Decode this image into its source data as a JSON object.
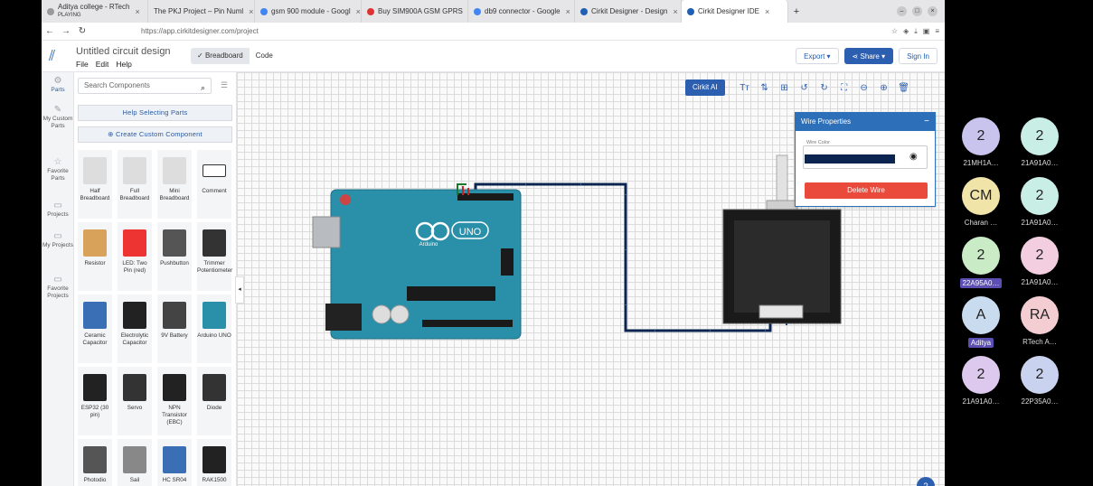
{
  "tabs": [
    {
      "title": "Aditya college - RTech",
      "subtitle": "PLAYING"
    },
    {
      "title": "The PKJ Project – Pin Numl"
    },
    {
      "title": "gsm 900 module - Googl"
    },
    {
      "title": "Buy SIM900A GSM GPRS"
    },
    {
      "title": "db9 connector - Google"
    },
    {
      "title": "Cirkit Designer - Design"
    },
    {
      "title": "Cirkit Designer IDE"
    }
  ],
  "url": "https://app.cirkitdesigner.com/project",
  "app": {
    "doc_title": "Untitled circuit design",
    "menu": [
      "File",
      "Edit",
      "Help"
    ],
    "view_tabs": [
      "Breadboard",
      "Code"
    ],
    "export_label": "Export",
    "share_label": "Share",
    "signin_label": "Sign In"
  },
  "rail": [
    "Parts",
    "My Custom Parts",
    "Favorite Parts",
    "Projects",
    "My Projects",
    "Favorite Projects"
  ],
  "parts_panel": {
    "search_placeholder": "Search Components",
    "help_button": "Help Selecting Parts",
    "create_button": "Create Custom Component",
    "cards": [
      "Half Breadboard",
      "Full Breadboard",
      "Mini Breadboard",
      "Comment",
      "Resistor",
      "LED: Two Pin (red)",
      "Pushbutton",
      "Trimmer Potentiometer",
      "Ceramic Capacitor",
      "Electrolytic Capacitor",
      "9V Battery",
      "Arduino UNO",
      "ESP32 (30 pin)",
      "Servo",
      "NPN Transistor (EBC)",
      "Diode",
      "Photodio",
      "Sail",
      "HC SR04",
      "RAK1500"
    ]
  },
  "toolbar": {
    "ai_label": "Cirkit AI"
  },
  "wire_panel": {
    "title": "Wire Properties",
    "color_label": "Wire Color",
    "wire_color": "#0b2550",
    "delete_label": "Delete Wire"
  },
  "board": {
    "logo_text": "UNO",
    "brand": "Arduino"
  },
  "participants": [
    {
      "initials": "2",
      "name": "21MH1A…",
      "color": "#c9c4ee"
    },
    {
      "initials": "2",
      "name": "21A91A0…",
      "color": "#c9eee5"
    },
    {
      "initials": "CM",
      "name": "Charan …",
      "color": "#f1e4a8"
    },
    {
      "initials": "2",
      "name": "21A91A0…",
      "color": "#c9eee5"
    },
    {
      "initials": "2",
      "name": "22A95A0…",
      "color": "#c9ecc7",
      "highlight": true
    },
    {
      "initials": "2",
      "name": "21A91A0…",
      "color": "#f3cde0"
    },
    {
      "initials": "A",
      "name": "Aditya",
      "color": "#c9dbee",
      "highlight": true
    },
    {
      "initials": "RA",
      "name": "RTech A…",
      "color": "#f3cdd2"
    },
    {
      "initials": "2",
      "name": "21A91A0…",
      "color": "#ddc9ee"
    },
    {
      "initials": "2",
      "name": "22P35A0…",
      "color": "#c9d2ee"
    }
  ]
}
